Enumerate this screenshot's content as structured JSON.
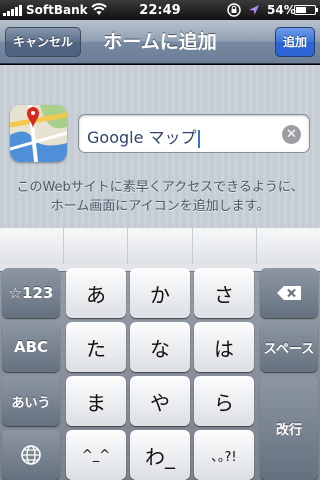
{
  "status_bar": {
    "carrier": "SoftBank",
    "time": "22:49",
    "battery_percent_label": "54%",
    "battery_level": 0.54,
    "icons": [
      "signal-icon",
      "wifi-icon",
      "rotation-lock-icon",
      "location-icon",
      "battery-icon"
    ]
  },
  "nav": {
    "cancel_label": "キャンセル",
    "title": "ホームに追加",
    "add_label": "追加"
  },
  "content": {
    "app_icon": "maps-app-icon",
    "name_value": "Google マップ",
    "hint_text": "このWebサイトに素早くアクセスできるように、ホーム画面にアイコンを追加します。"
  },
  "keyboard": {
    "mode_key": "☆123",
    "abc_key": "ABC",
    "aiu_key": "あいう",
    "globe_icon": "globe-icon",
    "keys": {
      "a": "あ",
      "ka": "か",
      "sa": "さ",
      "ta": "た",
      "na": "な",
      "ha": "は",
      "ma": "ま",
      "ya": "や",
      "ra": "ら",
      "kaomoji": "^_^",
      "wa": "わ_",
      "punct": "､｡?!"
    },
    "backspace_icon": "backspace-icon",
    "space_label": "スペース",
    "return_label": "改行"
  },
  "colors": {
    "nav_add_accent": "#2c66d6",
    "caret": "#3b6fd7"
  }
}
